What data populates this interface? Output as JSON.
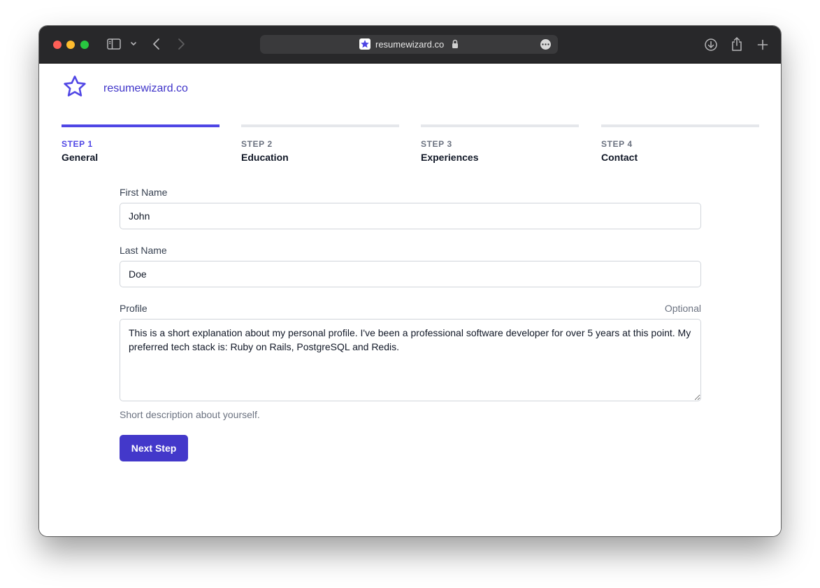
{
  "browser": {
    "url": "resumewizard.co",
    "icons": [
      "close-dot",
      "minimize-dot",
      "zoom-dot",
      "sidebar-icon",
      "chevron-down-icon",
      "back-icon",
      "forward-icon",
      "favicon-star-icon",
      "lock-icon",
      "more-icon",
      "download-icon",
      "share-icon",
      "new-tab-icon"
    ]
  },
  "brand": {
    "name": "resumewizard.co",
    "logo_icon": "star-icon"
  },
  "steps": [
    {
      "number": "STEP 1",
      "name": "General",
      "active": true
    },
    {
      "number": "STEP 2",
      "name": "Education",
      "active": false
    },
    {
      "number": "STEP 3",
      "name": "Experiences",
      "active": false
    },
    {
      "number": "STEP 4",
      "name": "Contact",
      "active": false
    }
  ],
  "form": {
    "first_name": {
      "label": "First Name",
      "value": "John"
    },
    "last_name": {
      "label": "Last Name",
      "value": "Doe"
    },
    "profile": {
      "label": "Profile",
      "optional": "Optional",
      "value": "This is a short explanation about my personal profile. I've been a professional software developer for over 5 years at this point. My preferred tech stack is: Ruby on Rails, PostgreSQL and Redis.",
      "help": "Short description about yourself."
    },
    "submit_label": "Next Step"
  },
  "colors": {
    "accent": "#4f46e5",
    "button": "#4338ca",
    "brand_text": "#3f34c9",
    "inactive_bar": "#e5e7eb"
  }
}
